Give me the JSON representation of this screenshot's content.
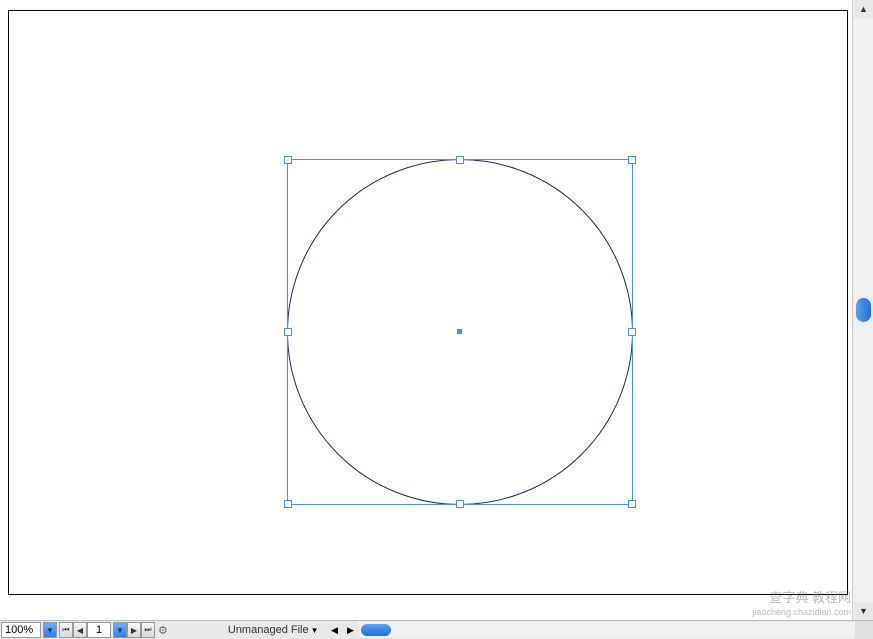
{
  "canvas": {
    "shape": "circle",
    "selected": true
  },
  "statusbar": {
    "zoom": "100%",
    "page_current": "1",
    "file_status": "Unmanaged File"
  },
  "watermark": {
    "line1": "查字典 教程网",
    "line2": "jiaocheng.chazidian.com"
  },
  "icons": {
    "up": "▲",
    "down": "▼",
    "left": "◀",
    "right": "▶",
    "first": "⏮",
    "prev": "◀",
    "next": "▶",
    "last": "⏭",
    "popup": "▼",
    "gear": "⚙"
  }
}
